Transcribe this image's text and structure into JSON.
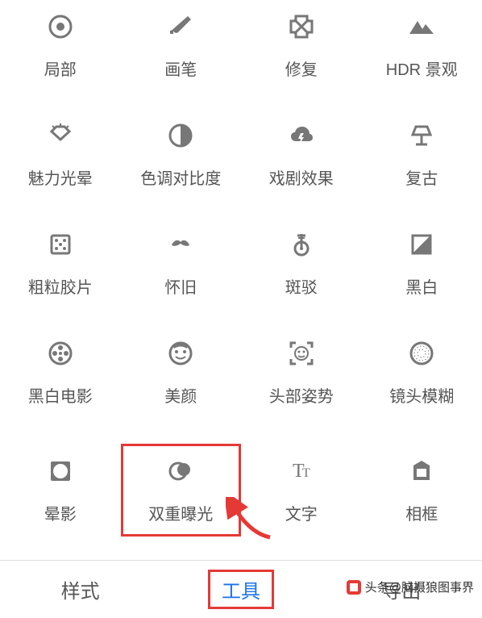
{
  "tools": [
    {
      "id": "selective",
      "label": "局部",
      "icon": "selective"
    },
    {
      "id": "brush",
      "label": "画笔",
      "icon": "brush"
    },
    {
      "id": "healing",
      "label": "修复",
      "icon": "healing"
    },
    {
      "id": "hdr",
      "label": "HDR 景观",
      "icon": "mountains"
    },
    {
      "id": "glamour",
      "label": "魅力光晕",
      "icon": "diamond"
    },
    {
      "id": "tonal",
      "label": "色调对比度",
      "icon": "halfcircle"
    },
    {
      "id": "drama",
      "label": "戏剧效果",
      "icon": "cloud"
    },
    {
      "id": "vintage",
      "label": "复古",
      "icon": "lamp"
    },
    {
      "id": "grainy",
      "label": "粗粒胶片",
      "icon": "film"
    },
    {
      "id": "retrolux",
      "label": "怀旧",
      "icon": "mustache"
    },
    {
      "id": "grunge",
      "label": "斑驳",
      "icon": "guitar"
    },
    {
      "id": "bw",
      "label": "黑白",
      "icon": "bwsplit"
    },
    {
      "id": "noir",
      "label": "黑白电影",
      "icon": "reel"
    },
    {
      "id": "portrait",
      "label": "美颜",
      "icon": "face"
    },
    {
      "id": "headpose",
      "label": "头部姿势",
      "icon": "facefocus"
    },
    {
      "id": "lensblur",
      "label": "镜头模糊",
      "icon": "blur"
    },
    {
      "id": "vignette",
      "label": "晕影",
      "icon": "vignette"
    },
    {
      "id": "doubleexposure",
      "label": "双重曝光",
      "icon": "double",
      "highlighted": true
    },
    {
      "id": "text",
      "label": "文字",
      "icon": "text"
    },
    {
      "id": "frames",
      "label": "相框",
      "icon": "frame"
    }
  ],
  "tabs": {
    "style": "样式",
    "tools": "工具",
    "export": "导出",
    "active": "tools"
  },
  "watermark": {
    "prefix": "头条",
    "account": "@脑摄狼图事界"
  }
}
